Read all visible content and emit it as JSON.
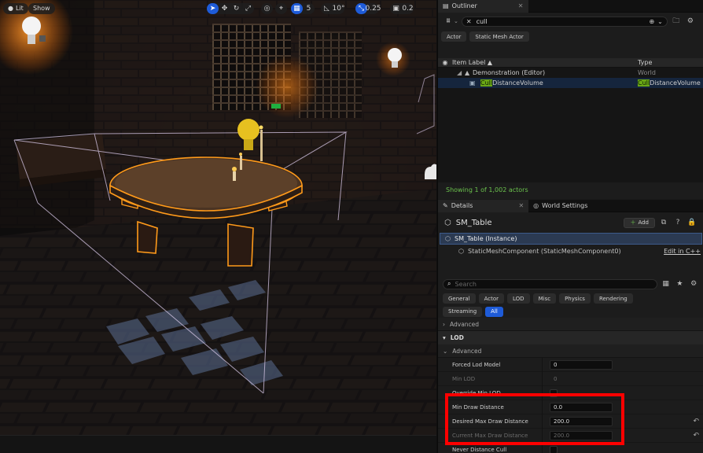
{
  "viewport": {
    "lit_label": "Lit",
    "show_label": "Show",
    "grid_value": "5",
    "angle_value": "10°",
    "scale_value": "0.25",
    "camera_value": "0.2"
  },
  "outliner": {
    "tab_title": "Outliner",
    "search_value": "cull",
    "filters": [
      "Actor",
      "Static Mesh Actor"
    ],
    "columns": {
      "label": "Item Label ▲",
      "type": "Type"
    },
    "rows": [
      {
        "label": "Demonstration (Editor)",
        "type": "World"
      },
      {
        "highlight": "Cull",
        "label_rest": "DistanceVolume",
        "type_highlight": "Cull",
        "type_rest": "DistanceVolume"
      }
    ],
    "footer": "Showing 1 of 1,002 actors"
  },
  "details": {
    "tab_details": "Details",
    "tab_world_settings": "World Settings",
    "actor_name": "SM_Table",
    "add_label": "Add",
    "instance_label": "SM_Table (Instance)",
    "component_label": "StaticMeshComponent (StaticMeshComponent0)",
    "edit_label": "Edit in C++",
    "search_placeholder": "Search",
    "filter_tabs": [
      "General",
      "Actor",
      "LOD",
      "Misc",
      "Physics",
      "Rendering",
      "Streaming",
      "All"
    ],
    "advanced_label": "Advanced",
    "lod_category": "LOD",
    "lod_advanced": "Advanced",
    "props": {
      "forced_lod_model": {
        "label": "Forced Lod Model",
        "value": "0"
      },
      "min_lod": {
        "label": "Min LOD",
        "value": "0"
      },
      "override_min_lod": {
        "label": "Override Min LOD"
      },
      "min_draw_distance": {
        "label": "Min Draw Distance",
        "value": "0.0"
      },
      "desired_max_draw_distance": {
        "label": "Desired Max Draw Distance",
        "value": "200.0"
      },
      "current_max_draw_distance": {
        "label": "Current Max Draw Distance",
        "value": "200.0"
      },
      "never_distance_cull": {
        "label": "Never Distance Cull"
      }
    }
  },
  "colors": {
    "accent": "#1e5bd8",
    "selection_outline": "#ff9a1a",
    "highlight_box": "#ff0000",
    "footer_text": "#6bc24d",
    "search_highlight": "#6aa816"
  }
}
